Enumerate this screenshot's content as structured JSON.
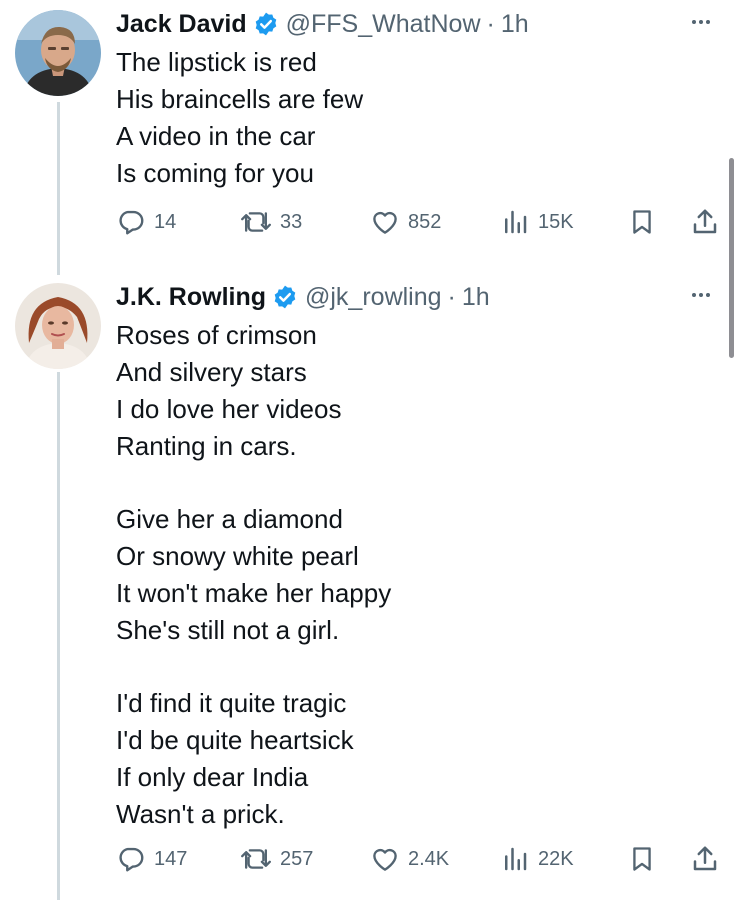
{
  "tweets": [
    {
      "name": "Jack David",
      "handle": "@FFS_WhatNow",
      "dot": "·",
      "time": "1h",
      "lines": [
        "The lipstick is red",
        "His braincells are few",
        "A video in the car",
        "Is coming for you"
      ],
      "replies": "14",
      "retweets": "33",
      "likes": "852",
      "views": "15K",
      "verified_icon": "verified-badge-icon"
    },
    {
      "name": "J.K. Rowling",
      "handle": "@jk_rowling",
      "dot": "·",
      "time": "1h",
      "stanzas": [
        [
          "Roses of crimson",
          "And silvery stars",
          "I do love her videos",
          "Ranting in cars."
        ],
        [
          "Give her a diamond",
          "Or snowy white pearl",
          "It won't make her happy",
          "She's still not a girl."
        ],
        [
          "I'd find it quite tragic",
          "I'd be quite heartsick",
          "If only dear India",
          "Wasn't a prick."
        ]
      ],
      "replies": "147",
      "retweets": "257",
      "likes": "2.4K",
      "views": "22K",
      "verified_icon": "verified-badge-icon"
    }
  ],
  "colors": {
    "text": "#0f1419",
    "secondary": "#536471",
    "verified": "#1d9bf0",
    "thread_line": "#cfd9de"
  }
}
